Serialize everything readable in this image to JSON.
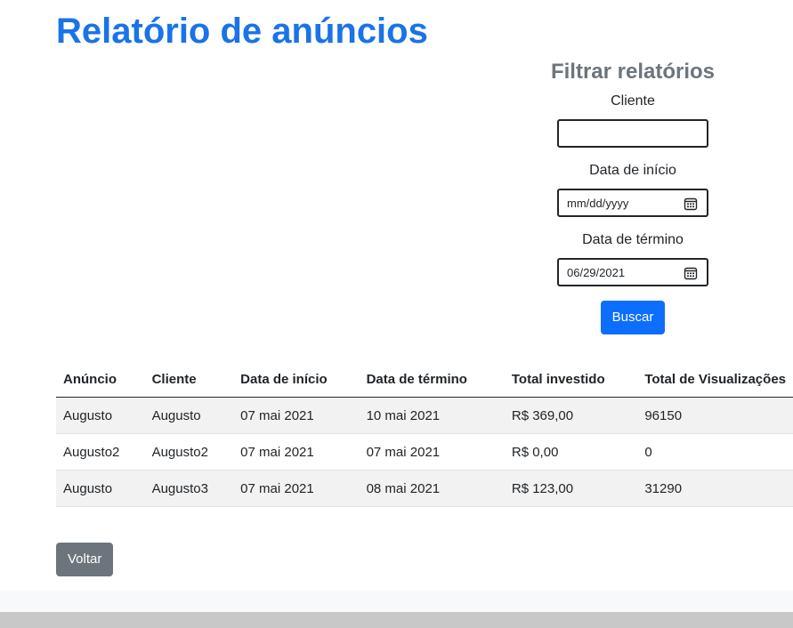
{
  "page": {
    "title": "Relatório de anúncios"
  },
  "filter": {
    "title": "Filtrar relatórios",
    "client_label": "Cliente",
    "client_value": "",
    "start_label": "Data de início",
    "start_value": "mm/dd/yyyy",
    "end_label": "Data de término",
    "end_value": "06/29/2021",
    "search_label": "Buscar",
    "calendar_icon": "calendar-icon"
  },
  "table": {
    "headers": [
      "Anúncio",
      "Cliente",
      "Data de início",
      "Data de término",
      "Total investido",
      "Total de Visualizações"
    ],
    "rows": [
      [
        "Augusto",
        "Augusto",
        "07 mai 2021",
        "10 mai 2021",
        "R$ 369,00",
        "96150"
      ],
      [
        "Augusto2",
        "Augusto2",
        "07 mai 2021",
        "07 mai 2021",
        "R$ 0,00",
        "0"
      ],
      [
        "Augusto",
        "Augusto3",
        "07 mai 2021",
        "08 mai 2021",
        "R$ 123,00",
        "31290"
      ]
    ]
  },
  "actions": {
    "back_label": "Voltar"
  },
  "colors": {
    "title": "#1a73e8",
    "primary": "#0d6efd",
    "secondary": "#6c757d",
    "stripe": "#f2f2f2"
  }
}
